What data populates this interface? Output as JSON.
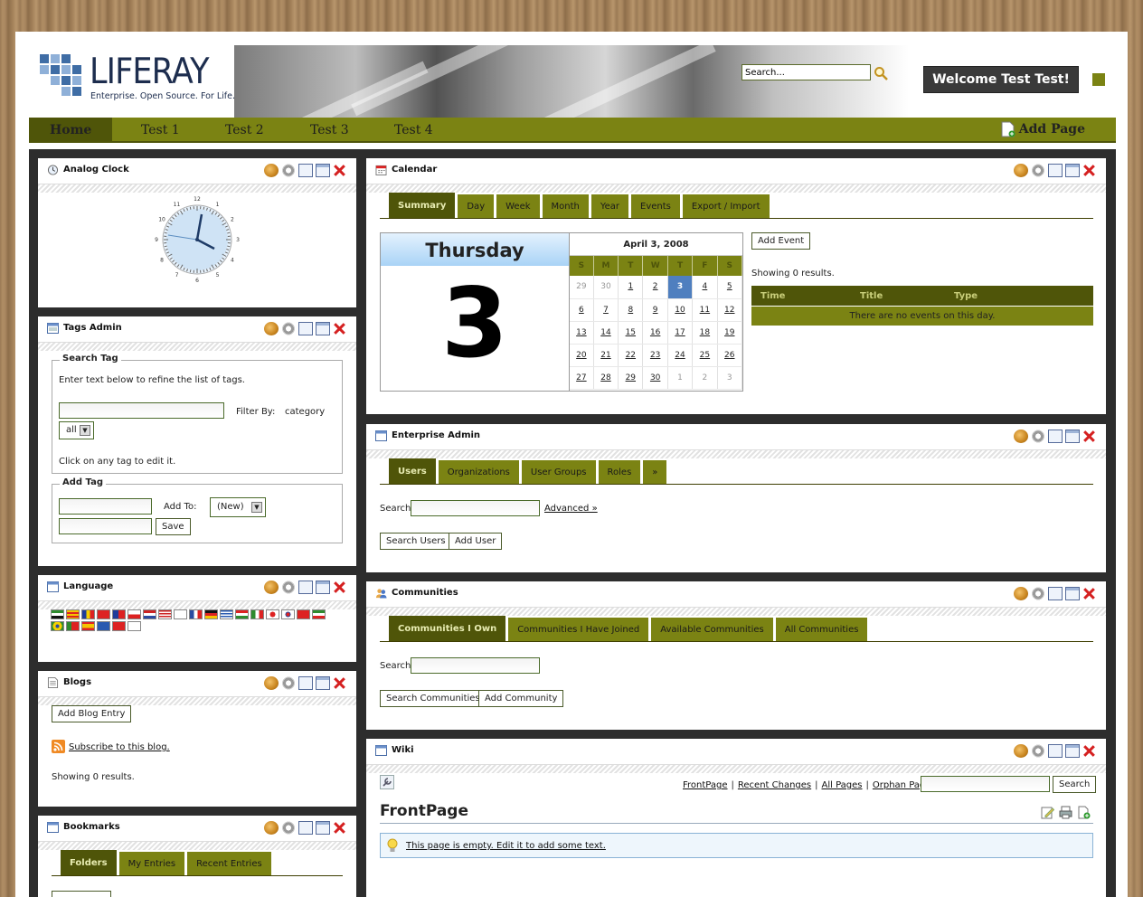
{
  "brand": {
    "name": "LIFERAY",
    "tagline": "Enterprise. Open Source. For Life."
  },
  "header": {
    "search_value": "Search...",
    "welcome": "Welcome Test Test!"
  },
  "nav": {
    "items": [
      "Home",
      "Test 1",
      "Test 2",
      "Test 3",
      "Test 4"
    ],
    "add_page": "Add Page"
  },
  "clock": {
    "title": "Analog Clock",
    "hour_labels": [
      "12",
      "1",
      "2",
      "3",
      "4",
      "5",
      "6",
      "7",
      "8",
      "9",
      "10",
      "11"
    ]
  },
  "tags_admin": {
    "title": "Tags Admin",
    "search_legend": "Search Tag",
    "hint": "Enter text below to refine the list of tags.",
    "filter_label": "Filter By:",
    "filter_value": "category",
    "select_value": "all",
    "click_hint": "Click on any tag to edit it.",
    "add_legend": "Add Tag",
    "add_to_label": "Add To:",
    "add_to_value": "(New)",
    "save": "Save"
  },
  "language": {
    "title": "Language"
  },
  "blogs": {
    "title": "Blogs",
    "add_entry": "Add Blog Entry",
    "subscribe": "Subscribe to this blog.",
    "showing": "Showing 0 results."
  },
  "bookmarks": {
    "title": "Bookmarks",
    "tabs": [
      "Folders",
      "My Entries",
      "Recent Entries"
    ]
  },
  "calendar": {
    "title": "Calendar",
    "tabs": [
      "Summary",
      "Day",
      "Week",
      "Month",
      "Year",
      "Events",
      "Export / Import"
    ],
    "day_name": "Thursday",
    "day_number": "3",
    "month_title": "April 3, 2008",
    "weekdays": [
      "S",
      "M",
      "T",
      "W",
      "T",
      "F",
      "S"
    ],
    "weeks": [
      [
        "29",
        "30",
        "1",
        "2",
        "3",
        "4",
        "5"
      ],
      [
        "6",
        "7",
        "8",
        "9",
        "10",
        "11",
        "12"
      ],
      [
        "13",
        "14",
        "15",
        "16",
        "17",
        "18",
        "19"
      ],
      [
        "20",
        "21",
        "22",
        "23",
        "24",
        "25",
        "26"
      ],
      [
        "27",
        "28",
        "29",
        "30",
        "1",
        "2",
        "3"
      ]
    ],
    "add_event": "Add Event",
    "showing": "Showing 0 results.",
    "columns": [
      "Time",
      "Title",
      "Type"
    ],
    "empty": "There are no events on this day."
  },
  "enterprise_admin": {
    "title": "Enterprise Admin",
    "tabs": [
      "Users",
      "Organizations",
      "User Groups",
      "Roles",
      "»"
    ],
    "search_label": "Search",
    "advanced": "Advanced »",
    "search_btn": "Search Users",
    "add_btn": "Add User"
  },
  "communities": {
    "title": "Communities",
    "tabs": [
      "Communities I Own",
      "Communities I Have Joined",
      "Available Communities",
      "All Communities"
    ],
    "search_label": "Search",
    "search_btn": "Search Communities",
    "add_btn": "Add Community"
  },
  "wiki": {
    "title": "Wiki",
    "links": [
      "FrontPage",
      "Recent Changes",
      "All Pages",
      "Orphan Pages"
    ],
    "search_btn": "Search",
    "page_title": "FrontPage",
    "empty_msg": "This page is empty. Edit it to add some text."
  },
  "colors": {
    "accent": "#7b8313",
    "accent_dark": "#4f5509",
    "frame": "#2d2d2d",
    "selected_day": "#4f7fbf"
  }
}
